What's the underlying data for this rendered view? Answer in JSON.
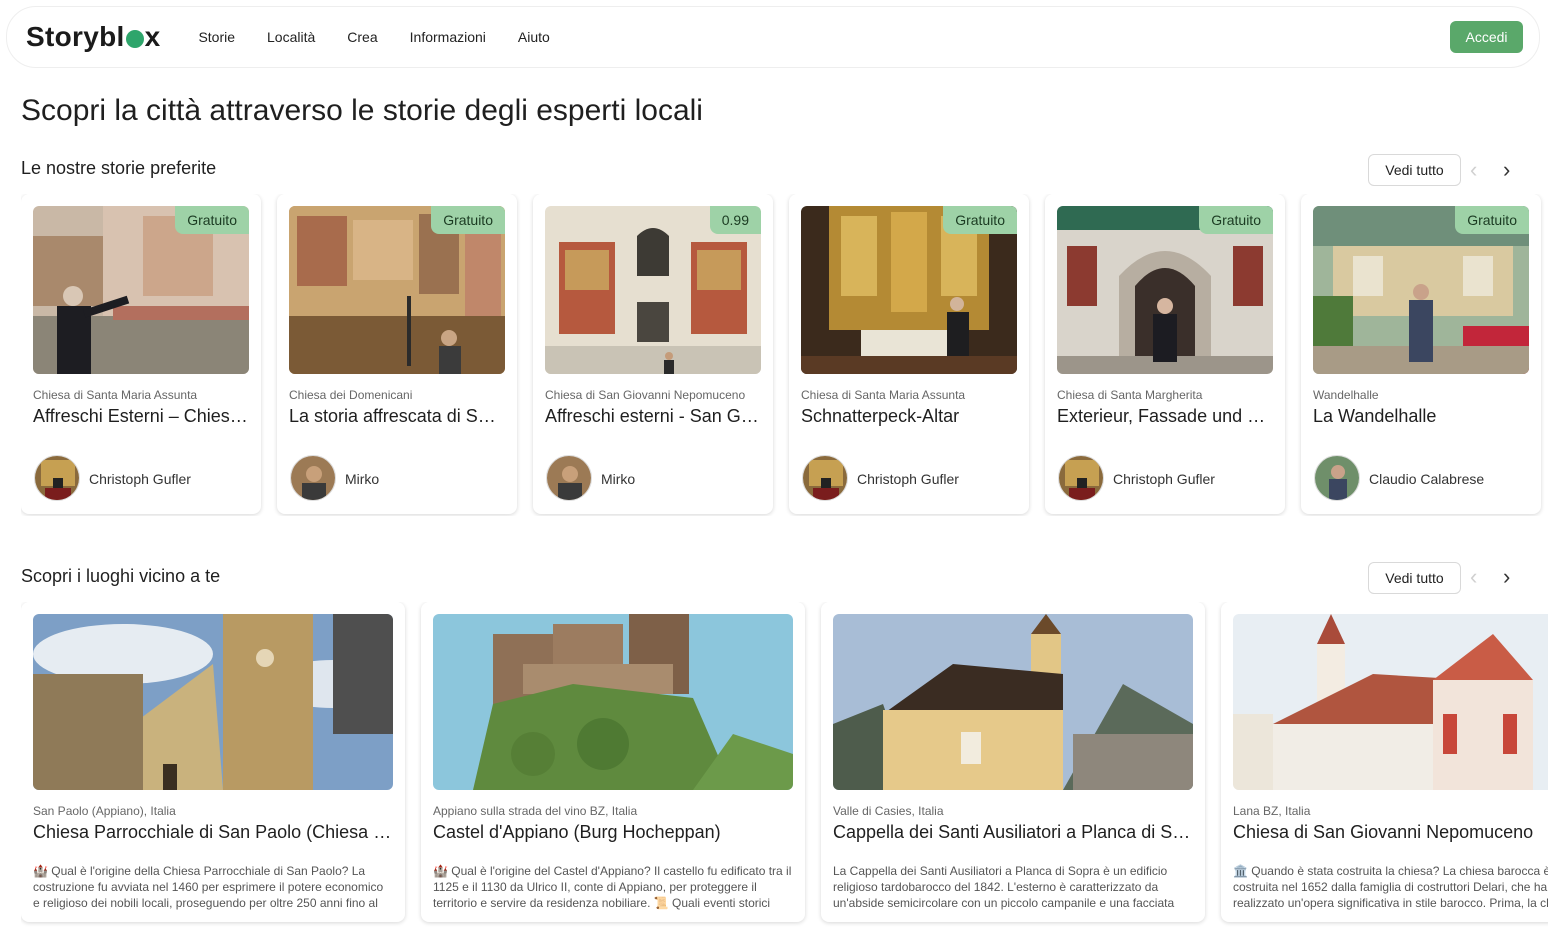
{
  "navbar": {
    "logo_left": "Storybl",
    "logo_right": "x",
    "links": [
      "Storie",
      "Località",
      "Crea",
      "Informazioni",
      "Aiuto"
    ],
    "login_label": "Accedi"
  },
  "page_title": "Scopri la città attraverso le storie degli esperti locali",
  "favorites": {
    "title": "Le nostre storie preferite",
    "see_all": "Vedi tutto",
    "cards": [
      {
        "badge": "Gratuito",
        "location": "Chiesa di Santa Maria Assunta",
        "title": "Affreschi Esterni – Chiesa di Santa Maria Assunta",
        "author": "Christoph Gufler"
      },
      {
        "badge": "Gratuito",
        "location": "Chiesa dei Domenicani",
        "title": "La storia affrescata di San Domenico",
        "author": "Mirko"
      },
      {
        "badge": "0.99",
        "location": "Chiesa di San Giovanni Nepomuceno",
        "title": "Affreschi esterni - San Giovanni Nepomuceno",
        "author": "Mirko"
      },
      {
        "badge": "Gratuito",
        "location": "Chiesa di Santa Maria Assunta",
        "title": "Schnatterpeck-Altar",
        "author": "Christoph Gufler"
      },
      {
        "badge": "Gratuito",
        "location": "Chiesa di Santa Margherita",
        "title": "Exterieur, Fassade und Portal",
        "author": "Christoph Gufler"
      },
      {
        "badge": "Gratuito",
        "location": "Wandelhalle",
        "title": "La Wandelhalle",
        "author": "Claudio Calabrese"
      }
    ]
  },
  "places": {
    "title": "Scopri i luoghi vicino a te",
    "see_all": "Vedi tutto",
    "cards": [
      {
        "location": "San Paolo (Appiano), Italia",
        "title": "Chiesa Parrocchiale di San Paolo (Chiesa dei Santi Pietro e Paolo)",
        "description": "🏰 Qual è l'origine della Chiesa Parrocchiale di San Paolo? La costruzione fu avviata nel 1460 per esprimere il potere economico e religioso dei nobili locali, proseguendo per oltre 250 anni fino al completamento."
      },
      {
        "location": "Appiano sulla strada del vino BZ, Italia",
        "title": "Castel d'Appiano (Burg Hocheppan)",
        "description": "🏰 Qual è l'origine del Castel d'Appiano? Il castello fu edificato tra il 1125 e il 1130 da Ulrico II, conte di Appiano, per proteggere il territorio e servire da residenza nobiliare. 📜 Quali eventi storici hanno segnato il castello?"
      },
      {
        "location": "Valle di Casies, Italia",
        "title": "Cappella dei Santi Ausiliatori a Planca di Sopra",
        "description": "La Cappella dei Santi Ausiliatori a Planca di Sopra è un edificio religioso tardobarocco del 1842. L'esterno è caratterizzato da un'abside semicircolare con un piccolo campanile e una facciata semplice."
      },
      {
        "location": "Lana BZ, Italia",
        "title": "Chiesa di San Giovanni Nepomuceno",
        "description": "🏛️ Quando è stata costruita la chiesa? La chiesa barocca è stata costruita nel 1652 dalla famiglia di costruttori Delari, che ha realizzato un'opera significativa in stile barocco. Prima, la chiesa era"
      }
    ]
  }
}
